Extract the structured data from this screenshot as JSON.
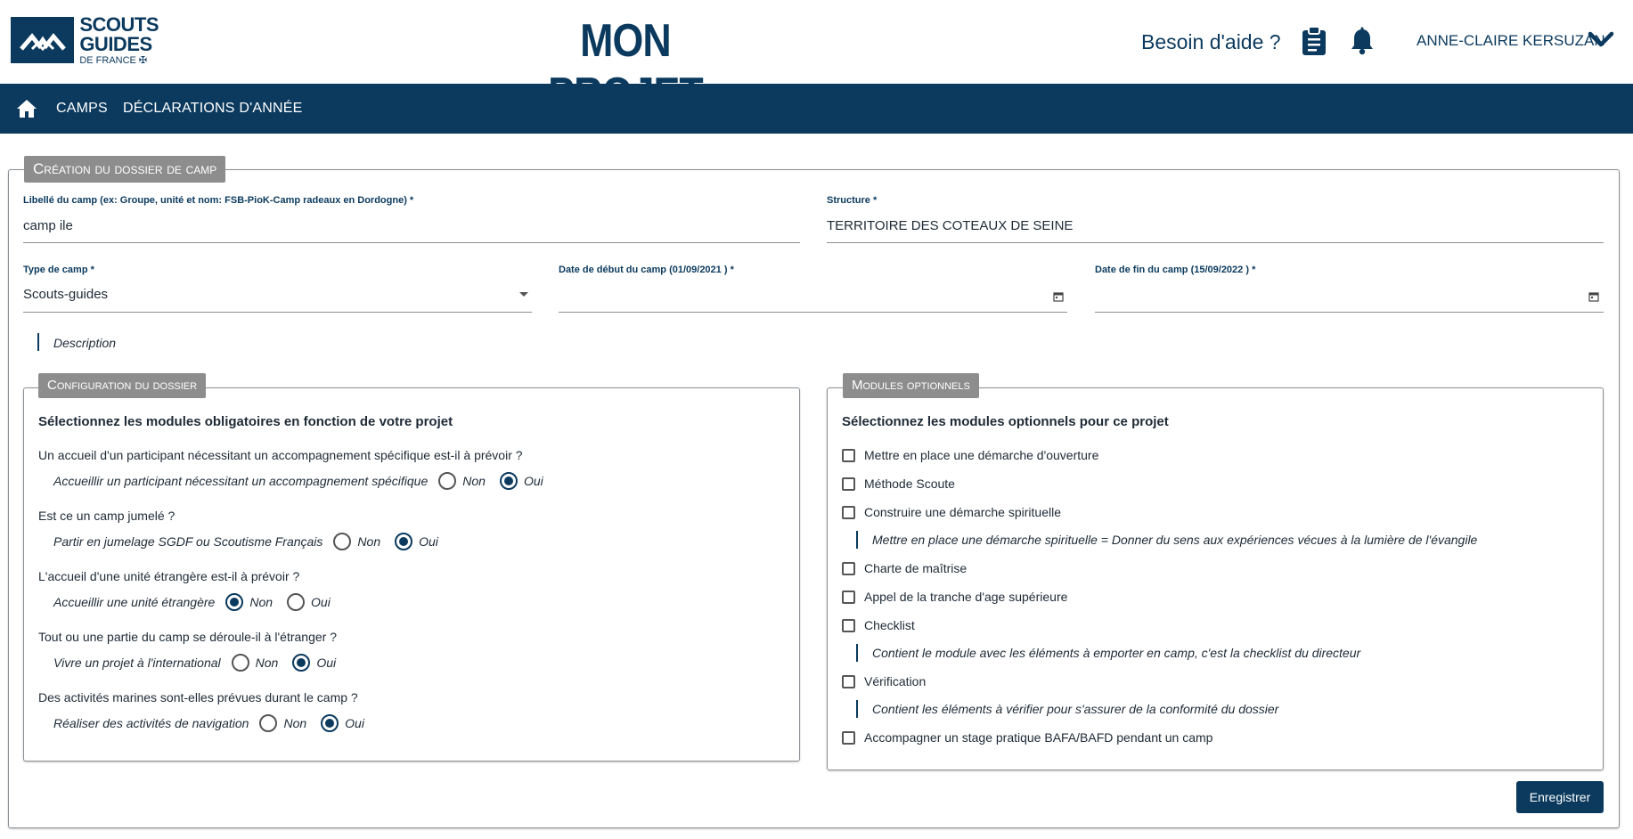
{
  "header": {
    "logo": {
      "line1": "SCOUTS",
      "line2": "GUIDES",
      "line3": "DE FRANCE ✠"
    },
    "title": "MON PROJET",
    "help": "Besoin d'aide ?",
    "user": "ANNE-CLAIRE KERSUZAN",
    "icons": [
      "clipboard-icon",
      "bell-icon",
      "chevron-down-icon"
    ]
  },
  "nav": {
    "items": [
      {
        "label": "CAMPS"
      },
      {
        "label": "DÉCLARATIONS D'ANNÉE"
      }
    ]
  },
  "form": {
    "legend": "Création du dossier de camp",
    "libelle": {
      "label": "Libellé du camp (ex: Groupe, unité et nom: FSB-PioK-Camp radeaux en Dordogne) *",
      "value": "camp ile"
    },
    "structure": {
      "label": "Structure *",
      "value": "TERRITOIRE DES COTEAUX DE SEINE"
    },
    "type": {
      "label": "Type de camp *",
      "value": "Scouts-guides"
    },
    "date_debut": {
      "label": "Date de début du camp (01/09/2021 ) *",
      "value": ""
    },
    "date_fin": {
      "label": "Date de fin du camp (15/09/2022 ) *",
      "value": ""
    },
    "description": "Description"
  },
  "configuration": {
    "legend": "Configuration du dossier",
    "heading": "Sélectionnez les modules obligatoires en fonction de votre projet",
    "option_non": "Non",
    "option_oui": "Oui",
    "questions": [
      {
        "question": "Un accueil d'un participant nécessitant un accompagnement spécifique est-il à prévoir ?",
        "answer": "Accueillir un participant nécessitant un accompagnement spécifique",
        "selected": "Oui"
      },
      {
        "question": "Est ce un camp jumelé ?",
        "answer": "Partir en jumelage SGDF ou Scoutisme Français",
        "selected": "Oui"
      },
      {
        "question": "L'accueil d'une unité étrangère est-il à prévoir ?",
        "answer": "Accueillir une unité étrangère",
        "selected": "Non"
      },
      {
        "question": "Tout ou une partie du camp se déroule-il à l'étranger ?",
        "answer": "Vivre un projet à l'international",
        "selected": "Oui"
      },
      {
        "question": "Des activités marines sont-elles prévues durant le camp ?",
        "answer": "Réaliser des activités de navigation",
        "selected": "Oui"
      }
    ]
  },
  "modules": {
    "legend": "Modules optionnels",
    "heading": "Sélectionnez les modules optionnels pour ce projet",
    "items": [
      {
        "label": "Mettre en place une démarche d'ouverture",
        "checked": false
      },
      {
        "label": "Méthode Scoute",
        "checked": false
      },
      {
        "label": "Construire une démarche spirituelle",
        "checked": false,
        "desc": "Mettre en place une démarche spirituelle = Donner du sens aux expériences vécues à la lumière de l'évangile"
      },
      {
        "label": "Charte de maîtrise",
        "checked": false
      },
      {
        "label": "Appel de la tranche d'age supérieure",
        "checked": false
      },
      {
        "label": "Checklist",
        "checked": false,
        "desc": "Contient le module avec les éléments à emporter en camp, c'est la checklist du directeur"
      },
      {
        "label": "Vérification",
        "checked": false,
        "desc": "Contient les éléments à vérifier pour s'assurer de la conformité du dossier"
      },
      {
        "label": "Accompagner un stage pratique BAFA/BAFD pendant un camp",
        "checked": false
      }
    ]
  },
  "actions": {
    "save": "Enregistrer"
  },
  "colors": {
    "brand": "#0b3a5e",
    "legend_bg": "#8d8d8d"
  }
}
